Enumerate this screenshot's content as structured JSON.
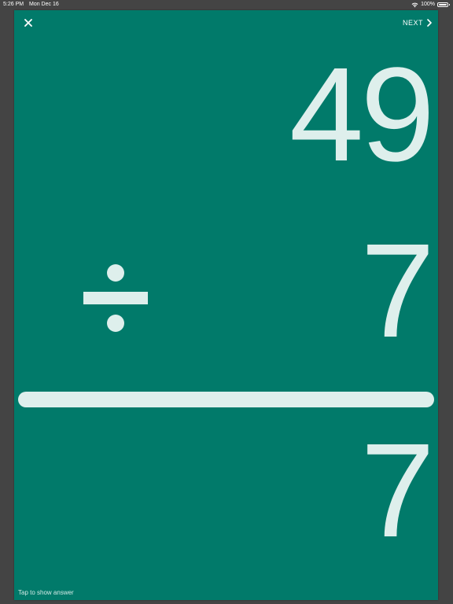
{
  "status_bar": {
    "time": "5:26 PM",
    "date": "Mon Dec 16",
    "battery": "100%",
    "icons": [
      "wifi-icon",
      "battery-icon"
    ]
  },
  "toolbar": {
    "close_icon": "close-icon",
    "next_label": "NEXT",
    "next_icon": "chevron-right-icon"
  },
  "problem": {
    "dividend": "49",
    "divisor": "7",
    "operator": "÷",
    "operator_icon": "division-icon",
    "answer": "7"
  },
  "hint": "Tap to show answer",
  "colors": {
    "card_background": "#017a6a",
    "digit_color": "#deefec",
    "screen_background": "#444444"
  }
}
